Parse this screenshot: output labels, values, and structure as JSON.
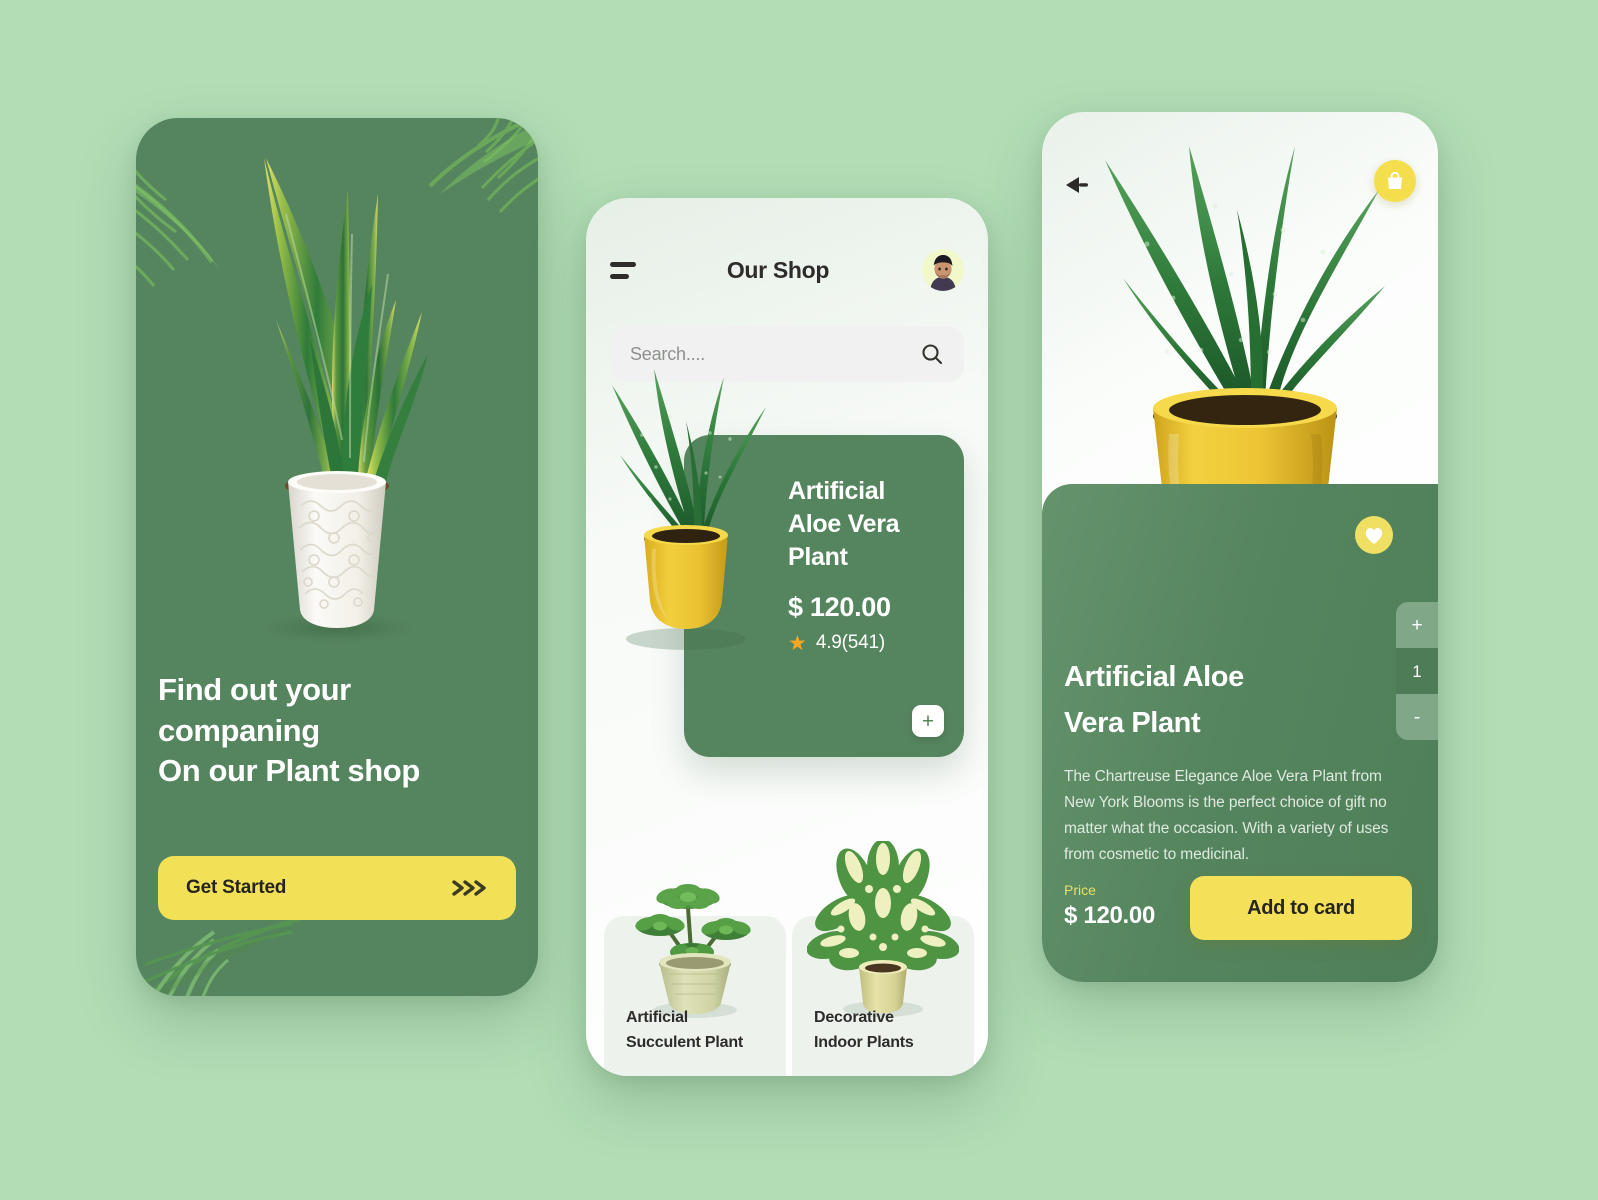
{
  "theme": {
    "page_bg": "#b2ddb5",
    "brand_green": "#55855e",
    "brand_yellow": "#f2e157",
    "text_dark": "#2e2c2a",
    "star_orange": "#f5a623"
  },
  "onboarding": {
    "headline_lines": [
      "Find out your",
      "companing",
      "On our Plant shop"
    ],
    "cta_label": "Get Started",
    "cta_icon": "chevrons-right-icon",
    "hero_icon": "snake-plant-image"
  },
  "shop": {
    "menu_icon": "hamburger-menu-icon",
    "title": "Our Shop",
    "avatar_icon": "user-avatar",
    "search": {
      "placeholder": "Search....",
      "value": "",
      "icon": "search-icon"
    },
    "featured": {
      "name": "Artificial\nAloe Vera\nPlant",
      "price": "$ 120.00",
      "rating": "4.9(541)",
      "star_icon": "star-icon",
      "add_label": "+",
      "image": "aloe-vera-yellow-pot-image"
    },
    "tiles": [
      {
        "label": "Artificial\nSucculent Plant",
        "image": "succulent-plant-image"
      },
      {
        "label": "Decorative\nIndoor Plants",
        "image": "decorative-indoor-plant-image"
      }
    ]
  },
  "detail": {
    "back_icon": "back-arrow-icon",
    "bag_icon": "shopping-bag-icon",
    "hero_image": "aloe-vera-yellow-pot-image",
    "favorite_icon": "heart-icon",
    "stepper": {
      "increment_label": "+",
      "quantity": "1",
      "decrement_label": "-"
    },
    "title": "Artificial Aloe\nVera Plant",
    "description": "The Chartreuse Elegance Aloe Vera Plant from New York Blooms is the perfect choice of gift no matter what the occasion. With a variety of uses from cosmetic to medicinal.",
    "price_label": "Price",
    "price_value": "$ 120.00",
    "add_to_cart_label": "Add to card"
  }
}
